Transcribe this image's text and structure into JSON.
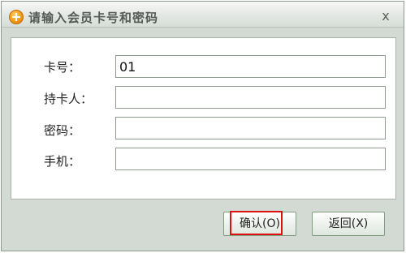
{
  "dialog": {
    "title": "请输入会员卡号和密码",
    "close_symbol": "ⅹ"
  },
  "form": {
    "card_label": "卡号：",
    "card_value": "01",
    "holder_label": "持卡人：",
    "holder_value": "",
    "password_label": "密码：",
    "password_value": "",
    "phone_label": "手机：",
    "phone_value": ""
  },
  "buttons": {
    "confirm_label": "确认(O)",
    "back_label": "返回(X)"
  },
  "icons": {
    "title_icon": "orange-plus-circle-icon",
    "close_icon": "close-x-icon"
  }
}
